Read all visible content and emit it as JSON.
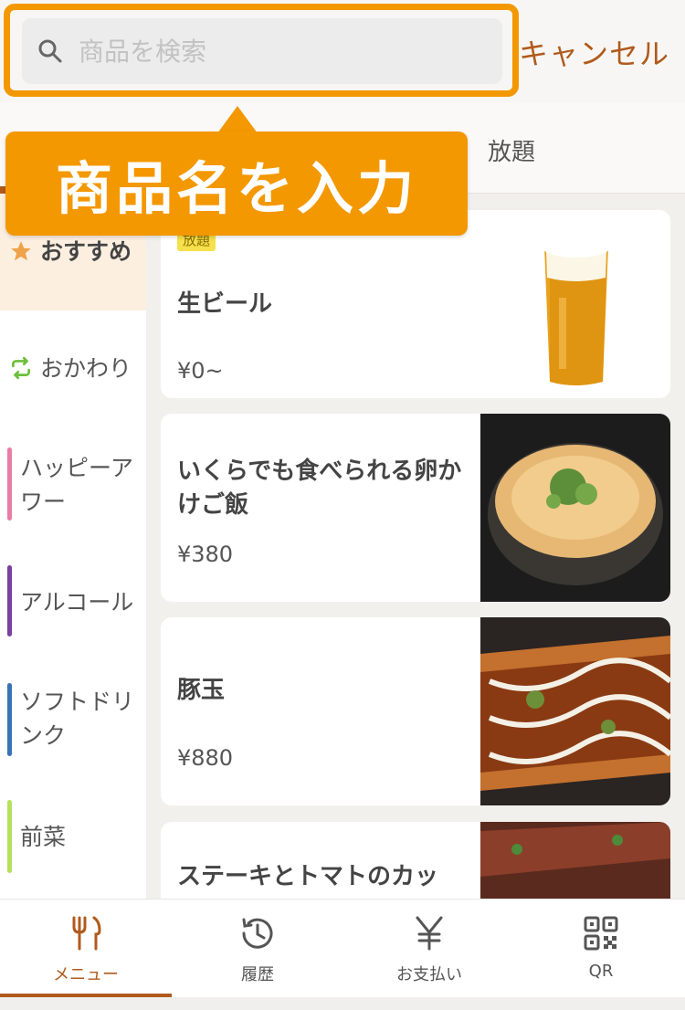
{
  "search": {
    "placeholder": "商品を検索",
    "value": "",
    "cancel_label": "キャンセル"
  },
  "tabs": {
    "visible_label": "放題"
  },
  "callout": {
    "text": "商品名を入力"
  },
  "sidebar": {
    "items": [
      {
        "label": "おすすめ",
        "icon": "star-icon",
        "active": true
      },
      {
        "label": "おかわり",
        "icon": "repeat-icon"
      },
      {
        "label": "ハッピーア\nワー",
        "color": "#e87ca6"
      },
      {
        "label": "アルコール",
        "color": "#7b3fa0"
      },
      {
        "label": "ソフトドリ\nンク",
        "color": "#3a73b5"
      },
      {
        "label": "前菜",
        "color": "#b6e05e"
      }
    ]
  },
  "menu": {
    "items": [
      {
        "badge": "放題",
        "name": "生ビール",
        "price": "¥0~",
        "image": "beer-image"
      },
      {
        "name": "いくらでも食べられる卵かけご飯",
        "price": "¥380",
        "image": "rice-bowl-image"
      },
      {
        "name": "豚玉",
        "price": "¥880",
        "image": "okonomiyaki-image"
      },
      {
        "name": "ステーキとトマトのカッ",
        "image": "steak-image"
      }
    ]
  },
  "bottom_nav": {
    "items": [
      {
        "label": "メニュー",
        "icon": "fork-knife-icon",
        "active": true
      },
      {
        "label": "履歴",
        "icon": "history-icon"
      },
      {
        "label": "お支払い",
        "icon": "yen-icon"
      },
      {
        "label": "QR",
        "icon": "qr-icon"
      }
    ]
  },
  "colors": {
    "accent": "#f39800",
    "brand": "#b05a1c",
    "sidebar_active_bg": "#fcefe0"
  }
}
